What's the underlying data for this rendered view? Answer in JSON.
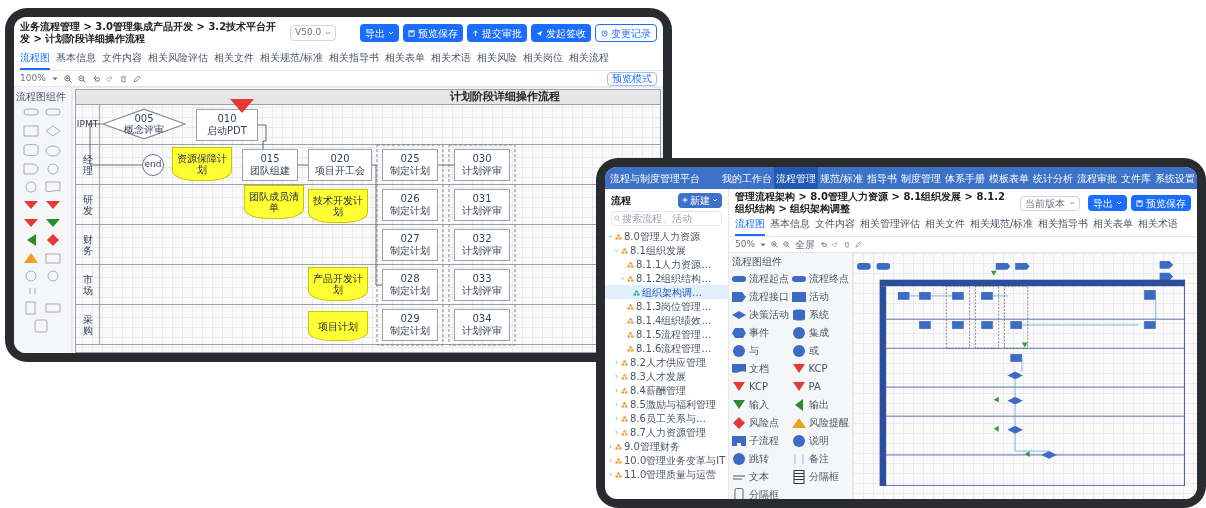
{
  "tablet_1": {
    "breadcrumb": "业务流程管理 > 3.0管理集成产品开发 > 3.2技术平台开发 > 计划阶段详细操作流程",
    "version_select": "V50.0",
    "buttons": [
      {
        "label": "导出",
        "kind": "dropdown"
      },
      {
        "label": "预览保存",
        "kind": "save"
      },
      {
        "label": "提交审批",
        "kind": "submit"
      },
      {
        "label": "发起签收",
        "kind": "send"
      },
      {
        "label": "变更记录",
        "kind": "history"
      }
    ],
    "tabs": [
      {
        "label": "流程图",
        "selected": true
      },
      {
        "label": "基本信息",
        "selected": false
      },
      {
        "label": "文件内容",
        "selected": false
      },
      {
        "label": "相关风险评估",
        "selected": false
      },
      {
        "label": "相关文件",
        "selected": false
      },
      {
        "label": "相关规范/标准",
        "selected": false
      },
      {
        "label": "相关指导书",
        "selected": false
      },
      {
        "label": "相关表单",
        "selected": false
      },
      {
        "label": "相关术语",
        "selected": false
      },
      {
        "label": "相关风险",
        "selected": false
      },
      {
        "label": "相关岗位",
        "selected": false
      },
      {
        "label": "相关流程",
        "selected": false
      }
    ],
    "zoom": "100%",
    "preview_button": "预览模式",
    "palette_title": "流程图组件",
    "diagram": {
      "title": "计划阶段详细操作流程",
      "lanes": [
        {
          "label": "IPMT"
        },
        {
          "label": "经理"
        },
        {
          "label": "研发"
        },
        {
          "label": "财务"
        },
        {
          "label": "市场"
        },
        {
          "label": "采购"
        }
      ],
      "nodes": [
        {
          "kind": "decision",
          "number": "005",
          "label": "概念评审"
        },
        {
          "kind": "process",
          "number": "010",
          "label": "启动PDT"
        },
        {
          "kind": "kcp"
        },
        {
          "kind": "end",
          "label": "end"
        },
        {
          "kind": "document",
          "label": "资源保障计划"
        },
        {
          "kind": "process",
          "number": "015",
          "label": "团队组建"
        },
        {
          "kind": "process",
          "number": "020",
          "label": "项目开工会"
        },
        {
          "kind": "document",
          "label": "团队成员清单"
        },
        {
          "kind": "document",
          "label": "技术开发计划"
        },
        {
          "kind": "document",
          "label": "产品开发计划"
        },
        {
          "kind": "document",
          "label": "项目计划"
        },
        {
          "kind": "process",
          "number": "025",
          "label": "制定计划"
        },
        {
          "kind": "process",
          "number": "026",
          "label": "制定计划"
        },
        {
          "kind": "process",
          "number": "027",
          "label": "制定计划"
        },
        {
          "kind": "process",
          "number": "028",
          "label": "制定计划"
        },
        {
          "kind": "process",
          "number": "029",
          "label": "制定计划"
        },
        {
          "kind": "process",
          "number": "030",
          "label": "计划评审"
        },
        {
          "kind": "process",
          "number": "031",
          "label": "计划评审"
        },
        {
          "kind": "process",
          "number": "032",
          "label": "计划评审"
        },
        {
          "kind": "process",
          "number": "033",
          "label": "计划评审"
        },
        {
          "kind": "process",
          "number": "034",
          "label": "计划评审"
        }
      ]
    }
  },
  "tablet_2": {
    "app_title": "流程与制度管理平台",
    "nav": [
      {
        "label": "我的工作台",
        "selected": false
      },
      {
        "label": "流程管理",
        "selected": true
      },
      {
        "label": "规范/标准",
        "selected": false
      },
      {
        "label": "指导书",
        "selected": false
      },
      {
        "label": "制度管理",
        "selected": false
      },
      {
        "label": "体系手册",
        "selected": false
      },
      {
        "label": "模板表单",
        "selected": false
      },
      {
        "label": "统计分析",
        "selected": false
      },
      {
        "label": "流程审批",
        "selected": false
      },
      {
        "label": "文件库",
        "selected": false
      },
      {
        "label": "系统设置",
        "selected": false
      }
    ],
    "sidebar": {
      "title": "流程",
      "new_button": "新建",
      "search": {
        "placeholder": "搜索流程、活动"
      },
      "tree": [
        {
          "label": "8.0管理人力资源",
          "expanded": true,
          "selected": false,
          "children": [
            {
              "label": "8.1组织发展",
              "expanded": true,
              "selected": false,
              "children": [
                {
                  "label": "8.1.1人力资源…",
                  "selected": false
                },
                {
                  "label": "8.1.2组织结构…",
                  "expanded": true,
                  "selected": false,
                  "children": [
                    {
                      "label": "组织架构调…",
                      "selected": true
                    }
                  ]
                },
                {
                  "label": "8.1.3岗位管理…",
                  "selected": false
                },
                {
                  "label": "8.1.4组织绩效…",
                  "selected": false
                },
                {
                  "label": "8.1.5流程管理…",
                  "selected": false
                },
                {
                  "label": "8.1.6流程管理…",
                  "selected": false
                }
              ]
            },
            {
              "label": "8.2人才供应管理",
              "expanded": false,
              "selected": false
            },
            {
              "label": "8.3人才发展",
              "expanded": false,
              "selected": false
            },
            {
              "label": "8.4薪酬管理",
              "expanded": false,
              "selected": false
            },
            {
              "label": "8.5激励与福利管理",
              "expanded": false,
              "selected": false
            },
            {
              "label": "8.6员工关系与…",
              "expanded": false,
              "selected": false
            },
            {
              "label": "8.7人力资源管理",
              "expanded": false,
              "selected": false
            }
          ]
        },
        {
          "label": "9.0管理财务",
          "expanded": false,
          "selected": false
        },
        {
          "label": "10.0管理业务变革与IT",
          "expanded": false,
          "selected": false
        },
        {
          "label": "11.0管理质量与运营",
          "expanded": false,
          "selected": false
        }
      ]
    },
    "breadcrumb": "管理流程架构 > 8.0管理人力资源 > 8.1组织发展 > 8.1.2组织结构 > 组织架构调整",
    "version_select": "当前版本",
    "buttons": [
      {
        "label": "导出",
        "kind": "dropdown"
      },
      {
        "label": "预览保存",
        "kind": "save"
      }
    ],
    "tabs": [
      {
        "label": "流程图",
        "selected": true
      },
      {
        "label": "基本信息",
        "selected": false
      },
      {
        "label": "文件内容",
        "selected": false
      },
      {
        "label": "相关管理评估",
        "selected": false
      },
      {
        "label": "相关文件",
        "selected": false
      },
      {
        "label": "相关规范/标准",
        "selected": false
      },
      {
        "label": "相关指导书",
        "selected": false
      },
      {
        "label": "相关表单",
        "selected": false
      },
      {
        "label": "相关术语",
        "selected": false
      }
    ],
    "zoom": "50%",
    "fullscreen": "全屏",
    "palette_title": "流程图组件",
    "palette": [
      {
        "kind": "terminator",
        "label": "流程起点"
      },
      {
        "kind": "terminator",
        "label": "流程终点"
      },
      {
        "kind": "interface",
        "label": "流程接口"
      },
      {
        "kind": "process",
        "label": "活动"
      },
      {
        "kind": "decision",
        "label": "决策活动"
      },
      {
        "kind": "database",
        "label": "系统"
      },
      {
        "kind": "event",
        "label": "事件"
      },
      {
        "kind": "circle",
        "label": "集成"
      },
      {
        "kind": "circle",
        "label": "与"
      },
      {
        "kind": "circle",
        "label": "或"
      },
      {
        "kind": "document",
        "label": "文档"
      },
      {
        "kind": "kcp",
        "label": "KCP"
      },
      {
        "kind": "kcp",
        "label": "KCP"
      },
      {
        "kind": "kcp",
        "label": "PA"
      },
      {
        "kind": "input",
        "label": "输入"
      },
      {
        "kind": "output",
        "label": "输出"
      },
      {
        "kind": "risk",
        "label": "风险点"
      },
      {
        "kind": "warning",
        "label": "风险提醒"
      },
      {
        "kind": "subprocess",
        "label": "子流程"
      },
      {
        "kind": "circle",
        "label": "说明"
      },
      {
        "kind": "circle",
        "label": "跳转"
      },
      {
        "kind": "divider",
        "label": "备注"
      },
      {
        "kind": "text",
        "label": "文本"
      },
      {
        "kind": "lane",
        "label": "分隔框"
      },
      {
        "kind": "phone",
        "label": "分隔框"
      }
    ]
  }
}
